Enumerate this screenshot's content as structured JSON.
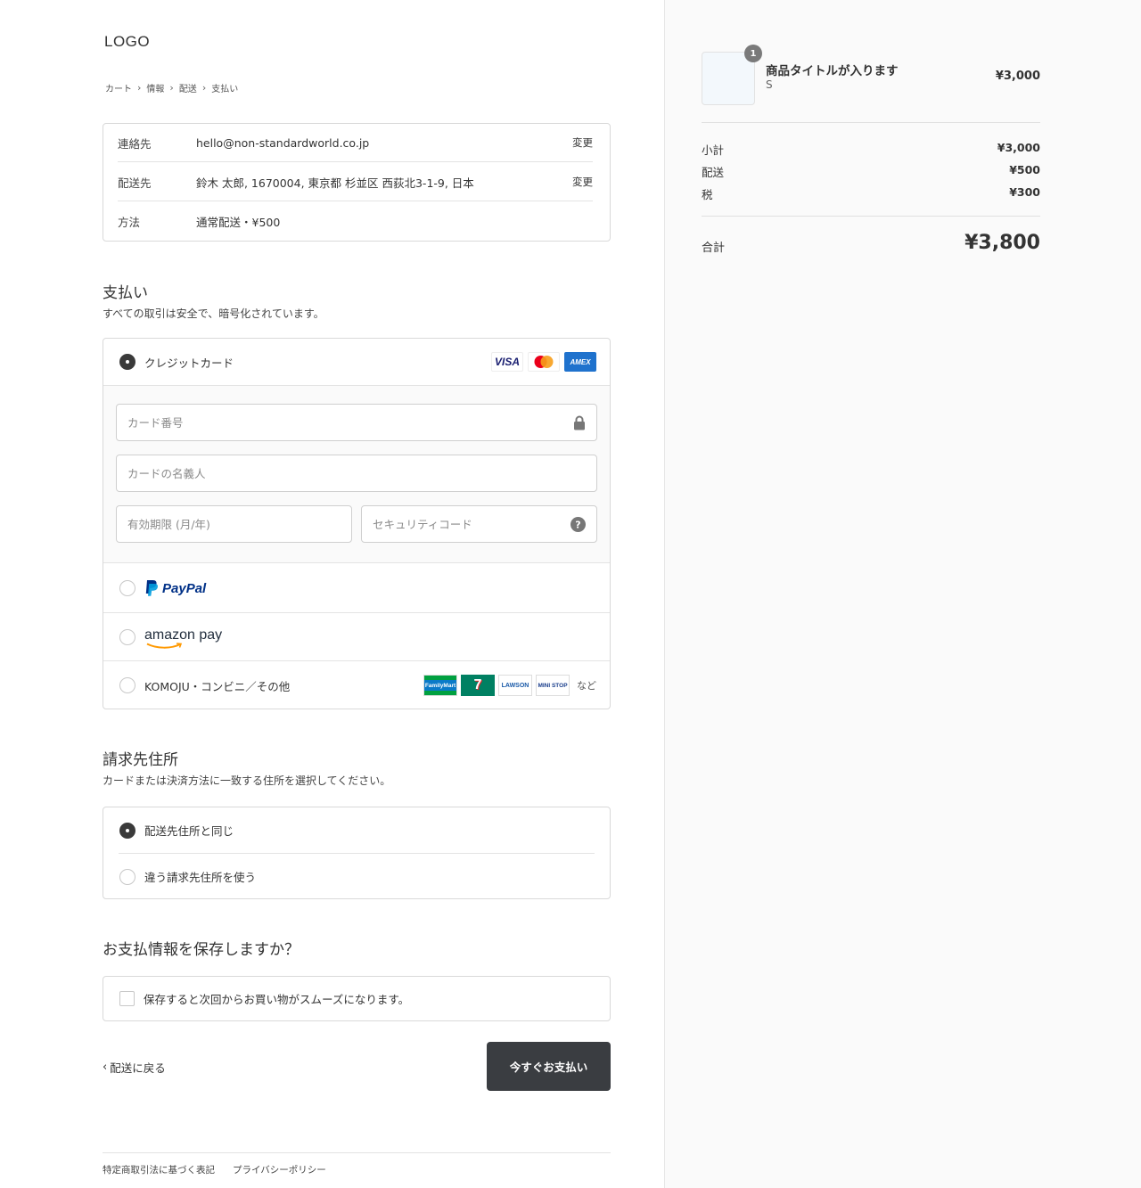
{
  "header": {
    "logo": "LOGO"
  },
  "breadcrumb": [
    "カート",
    "情報",
    "配送",
    "支払い"
  ],
  "summary": {
    "rows": [
      {
        "label": "連絡先",
        "value": "hello@non-standardworld.co.jp",
        "action": "変更"
      },
      {
        "label": "配送先",
        "value": "鈴木 太郎, 1670004, 東京都 杉並区 西荻北3-1-9, 日本",
        "action": "変更"
      },
      {
        "label": "方法",
        "value": "通常配送・¥500"
      }
    ]
  },
  "payment": {
    "title": "支払い",
    "subtitle": "すべての取引は安全で、暗号化されています。",
    "credit_label": "クレジットカード",
    "card_brands": [
      "VISA",
      "Mastercard",
      "AMEX"
    ],
    "card_number_placeholder": "カード番号",
    "card_name_placeholder": "カードの名義人",
    "expiry_placeholder": "有効期限 (月/年)",
    "security_placeholder": "セキュリティコード",
    "paypal_label": "PayPal",
    "amazon_label": "amazon pay",
    "komoju_label": "KOMOJU・コンビニ／その他",
    "cvs_brands": [
      "FamilyMart",
      "7",
      "LAWSON",
      "MINI STOP"
    ],
    "cvs_more": "など",
    "selected": "credit"
  },
  "billing": {
    "title": "請求先住所",
    "subtitle": "カードまたは決済方法に一致する住所を選択してください。",
    "option_same": "配送先住所と同じ",
    "option_diff": "違う請求先住所を使う"
  },
  "save": {
    "title": "お支払情報を保存しますか？",
    "checkbox_label": "保存すると次回からお買い物がスムーズになります。",
    "checked": false
  },
  "actions": {
    "back": "配送に戻る",
    "pay": "今すぐお支払い"
  },
  "footer": {
    "links": [
      "特定商取引法に基づく表記",
      "プライバシーポリシー"
    ]
  },
  "order": {
    "item": {
      "title": "商品タイトルが入ります",
      "variant": "S",
      "price": "¥3,000",
      "quantity": "1"
    },
    "subtotal_label": "小計",
    "subtotal": "¥3,000",
    "shipping_label": "配送",
    "shipping": "¥500",
    "tax_label": "税",
    "tax": "¥300",
    "total_label": "合計",
    "total": "¥3,800"
  },
  "colors": {
    "primary_button": "#3a3d41",
    "panel_bg": "#fafafa",
    "amex_blue": "#1f72cd",
    "paypal_dark": "#003087",
    "paypal_light": "#009cde"
  }
}
